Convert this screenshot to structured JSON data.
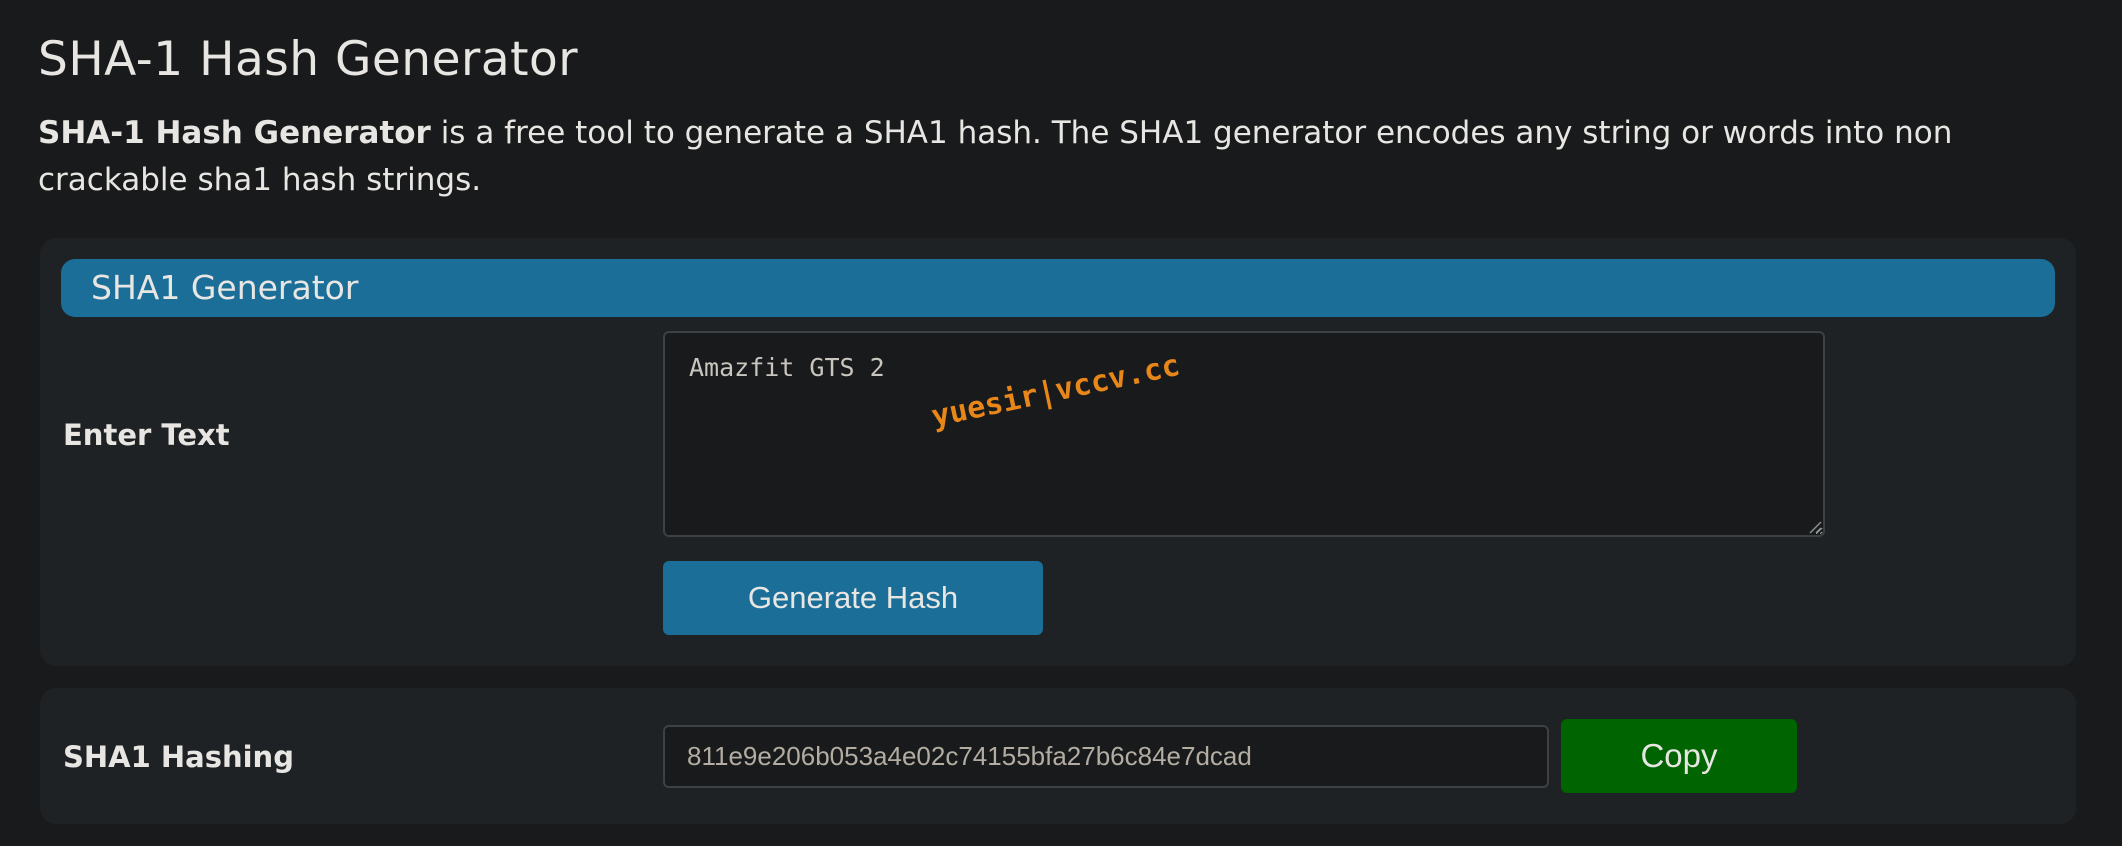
{
  "page": {
    "title": "SHA-1 Hash Generator",
    "intro_bold": "SHA-1 Hash Generator",
    "intro_rest": " is a free tool to generate a SHA1 hash. The SHA1 generator encodes any string or words into non crackable sha1 hash strings."
  },
  "generator": {
    "header_title": "SHA1 Generator",
    "input_label": "Enter Text",
    "input_value": "Amazfit GTS 2",
    "generate_label": "Generate Hash",
    "watermark": "yuesir|vccv.cc"
  },
  "result": {
    "label": "SHA1 Hashing",
    "hash_value": "811e9e206b053a4e02c74155bfa27b6c84e7dcad",
    "copy_label": "Copy"
  },
  "colors": {
    "background": "#181a1b",
    "card": "#1f2224",
    "accent": "#1a6e98",
    "copy_green": "#006400",
    "watermark": "#e8861a"
  },
  "icons": {
    "resize_grip": "resize-grip-icon"
  }
}
